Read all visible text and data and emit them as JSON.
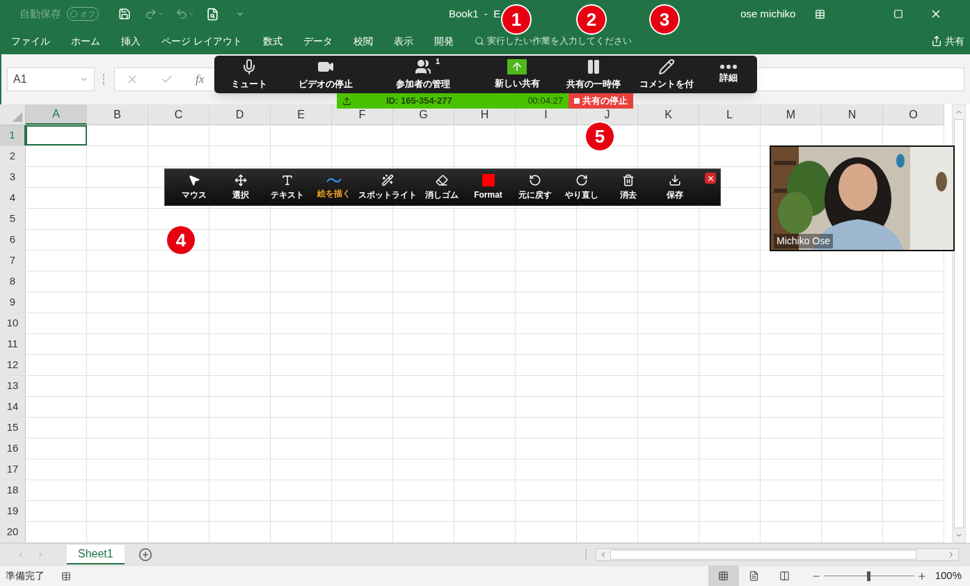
{
  "title_bar": {
    "autosave_label": "自動保存",
    "autosave_toggle": "オフ",
    "autosave_on": false,
    "title": "Book1  -  E",
    "user": "ose michiko"
  },
  "ribbon_tabs": [
    "ファイル",
    "ホーム",
    "挿入",
    "ページ レイアウト",
    "数式",
    "データ",
    "校閲",
    "表示",
    "開発"
  ],
  "search": {
    "placeholder": "実行したい作業を入力してください"
  },
  "share_button": "共有",
  "name_box": "A1",
  "function_label": "fx",
  "columns": [
    {
      "label": "A",
      "selected": true
    },
    {
      "label": "B",
      "selected": false
    },
    {
      "label": "C",
      "selected": false
    },
    {
      "label": "D",
      "selected": false
    },
    {
      "label": "E",
      "selected": false
    },
    {
      "label": "F",
      "selected": false
    },
    {
      "label": "G",
      "selected": false
    },
    {
      "label": "H",
      "selected": false
    },
    {
      "label": "I",
      "selected": false
    },
    {
      "label": "J",
      "selected": false
    },
    {
      "label": "K",
      "selected": false
    },
    {
      "label": "L",
      "selected": false
    },
    {
      "label": "M",
      "selected": false
    },
    {
      "label": "N",
      "selected": false
    },
    {
      "label": "O",
      "selected": false
    }
  ],
  "rows": [
    {
      "label": "1",
      "selected": true
    },
    {
      "label": "2",
      "selected": false
    },
    {
      "label": "3",
      "selected": false
    },
    {
      "label": "4",
      "selected": false
    },
    {
      "label": "5",
      "selected": false
    },
    {
      "label": "6",
      "selected": false
    },
    {
      "label": "7",
      "selected": false
    },
    {
      "label": "8",
      "selected": false
    },
    {
      "label": "9",
      "selected": false
    },
    {
      "label": "10",
      "selected": false
    },
    {
      "label": "11",
      "selected": false
    },
    {
      "label": "12",
      "selected": false
    },
    {
      "label": "13",
      "selected": false
    },
    {
      "label": "14",
      "selected": false
    },
    {
      "label": "15",
      "selected": false
    },
    {
      "label": "16",
      "selected": false
    },
    {
      "label": "17",
      "selected": false
    },
    {
      "label": "18",
      "selected": false
    },
    {
      "label": "19",
      "selected": false
    },
    {
      "label": "20",
      "selected": false
    }
  ],
  "sheet_tabs": [
    {
      "label": "Sheet1",
      "selected": true
    }
  ],
  "status_bar": {
    "status": "準備完了",
    "views": [
      {
        "selected": true
      },
      {
        "selected": false
      },
      {
        "selected": false
      }
    ],
    "zoom": {
      "level": 0.5,
      "reading": "100%"
    }
  },
  "meeting_toolbar": {
    "buttons": [
      {
        "kind": "mic",
        "label": "ミュート"
      },
      {
        "kind": "video",
        "label": "ビデオの停止"
      },
      {
        "kind": "participants",
        "label": "参加者の管理",
        "count": "1"
      },
      {
        "kind": "share",
        "label": "新しい共有"
      },
      {
        "kind": "pause",
        "label": "共有の一時停"
      },
      {
        "kind": "annotate",
        "label": "コメントを付"
      },
      {
        "kind": "more",
        "label": "詳細"
      }
    ]
  },
  "share_bar": {
    "meeting_id": "ID: 165-354-277",
    "elapsed": "00:04:27",
    "stop": "共有の停止"
  },
  "annotation_toolbar": {
    "tools": [
      {
        "kind": "mouse",
        "label": "マウス",
        "selected": false
      },
      {
        "kind": "select",
        "label": "選択",
        "selected": false
      },
      {
        "kind": "text",
        "label": "テキスト",
        "selected": false
      },
      {
        "kind": "draw",
        "label": "絵を描く",
        "selected": true
      },
      {
        "kind": "spotlight",
        "label": "スポットライト",
        "selected": false
      },
      {
        "kind": "eraser",
        "label": "消しゴム",
        "selected": false
      },
      {
        "kind": "format",
        "label": "Format",
        "selected": false,
        "color": "#ff0000"
      },
      {
        "kind": "undo",
        "label": "元に戻す",
        "selected": false
      },
      {
        "kind": "redo",
        "label": "やり直し",
        "selected": false
      },
      {
        "kind": "clear",
        "label": "消去",
        "selected": false
      },
      {
        "kind": "save",
        "label": "保存",
        "selected": false
      }
    ]
  },
  "video": {
    "kind": "picture",
    "name": "Michiko Ose"
  },
  "callouts": [
    "1",
    "2",
    "3",
    "4",
    "5"
  ]
}
